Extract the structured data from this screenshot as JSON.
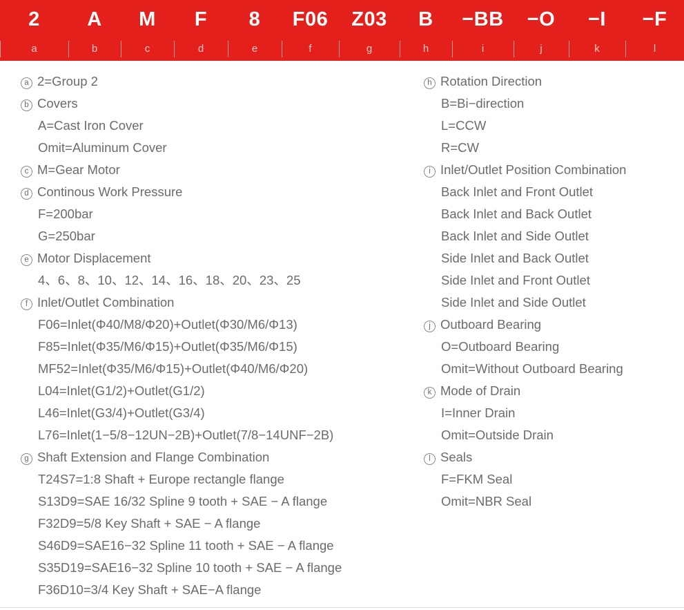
{
  "header": {
    "background_color": "#e3201c",
    "code_text_color": "#ffffff",
    "letter_text_color": "#ffc9c4",
    "segments": [
      {
        "code": "2",
        "letter": "a",
        "width": 99
      },
      {
        "code": "A",
        "letter": "b",
        "width": 76
      },
      {
        "code": "M",
        "letter": "c",
        "width": 77
      },
      {
        "code": "F",
        "letter": "d",
        "width": 78
      },
      {
        "code": "8",
        "letter": "e",
        "width": 78
      },
      {
        "code": "F06",
        "letter": "f",
        "width": 83
      },
      {
        "code": "Z03",
        "letter": "g",
        "width": 88
      },
      {
        "code": "B",
        "letter": "h",
        "width": 76
      },
      {
        "code": "−BB",
        "letter": "i",
        "width": 89
      },
      {
        "code": "−O",
        "letter": "j",
        "width": 80
      },
      {
        "code": "−I",
        "letter": "k",
        "width": 82
      },
      {
        "code": "−F",
        "letter": "l",
        "width": 85
      }
    ]
  },
  "legend": {
    "text_color": "#6b6b6b",
    "left_column": [
      {
        "marker": "a",
        "title": "2=Group 2",
        "sub_lines": []
      },
      {
        "marker": "b",
        "title": "Covers",
        "sub_lines": [
          "A=Cast Iron Cover",
          "Omit=Aluminum Cover"
        ]
      },
      {
        "marker": "c",
        "title": "M=Gear Motor",
        "sub_lines": []
      },
      {
        "marker": "d",
        "title": "Continous Work Pressure",
        "sub_lines": [
          "F=200bar",
          "G=250bar"
        ]
      },
      {
        "marker": "e",
        "title": "Motor Displacement",
        "sub_lines": [
          "4、6、8、10、12、14、16、18、20、23、25"
        ]
      },
      {
        "marker": "f",
        "title": "Inlet/Outlet Combination",
        "sub_lines": [
          "F06=Inlet(Φ40/M8/Φ20)+Outlet(Φ30/M6/Φ13)",
          "F85=Inlet(Φ35/M6/Φ15)+Outlet(Φ35/M6/Φ15)",
          "MF52=Inlet(Φ35/M6/Φ15)+Outlet(Φ40/M6/Φ20)",
          "L04=Inlet(G1/2)+Outlet(G1/2)",
          "L46=Inlet(G3/4)+Outlet(G3/4)",
          "L76=Inlet(1−5/8−12UN−2B)+Outlet(7/8−14UNF−2B)"
        ]
      },
      {
        "marker": "g",
        "title": "Shaft Extension and Flange Combination",
        "sub_lines": [
          "T24S7=1:8 Shaft + Europe rectangle flange",
          "S13D9=SAE 16/32 Spline 9 tooth + SAE − A flange",
          "F32D9=5/8 Key Shaft + SAE − A flange",
          "S46D9=SAE16−32 Spline 11 tooth + SAE − A flange",
          "S35D19=SAE16−32 Spline 10 tooth + SAE − A flange",
          "F36D10=3/4 Key Shaft + SAE−A flange"
        ]
      }
    ],
    "right_column": [
      {
        "marker": "h",
        "title": "Rotation Direction",
        "sub_lines": [
          "B=Bi−direction",
          "L=CCW",
          "R=CW"
        ]
      },
      {
        "marker": "i",
        "title": "Inlet/Outlet Position Combination",
        "sub_lines": [
          "Back Inlet and Front Outlet",
          "Back Inlet and Back Outlet",
          "Back Inlet and Side Outlet",
          "Side Inlet and Back Outlet",
          "Side Inlet and Front Outlet",
          "Side Inlet and Side Outlet"
        ]
      },
      {
        "marker": "j",
        "title": "Outboard Bearing",
        "sub_lines": [
          "O=Outboard Bearing",
          "Omit=Without Outboard Bearing"
        ]
      },
      {
        "marker": "k",
        "title": "Mode of  Drain",
        "sub_lines": [
          "I=Inner Drain",
          "Omit=Outside Drain"
        ]
      },
      {
        "marker": "l",
        "title": "Seals",
        "sub_lines": [
          "F=FKM Seal",
          "Omit=NBR Seal"
        ]
      }
    ]
  }
}
